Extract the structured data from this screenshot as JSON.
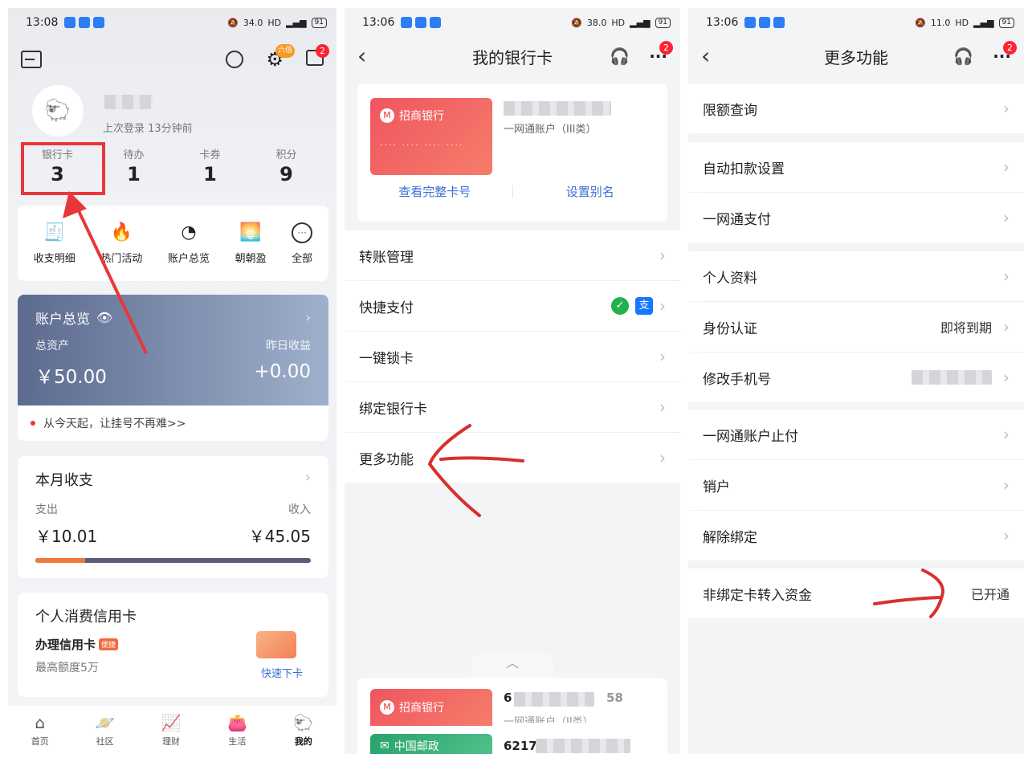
{
  "panel1": {
    "status": {
      "time": "13:08",
      "speed": "34.0",
      "net": "HD",
      "battery": "91"
    },
    "notif_count": "2",
    "vip_tag": "六倍",
    "profile": {
      "last_login": "上次登录 13分钟前"
    },
    "stats": [
      {
        "label": "银行卡",
        "value": "3"
      },
      {
        "label": "待办",
        "value": "1"
      },
      {
        "label": "卡券",
        "value": "1"
      },
      {
        "label": "积分",
        "value": "9"
      }
    ],
    "quick": [
      {
        "label": "收支明细",
        "icon": "receipt-icon"
      },
      {
        "label": "热门活动",
        "icon": "flame-icon"
      },
      {
        "label": "账户总览",
        "icon": "pie-chart-icon"
      },
      {
        "label": "朝朝盈",
        "icon": "sunrise-icon"
      },
      {
        "label": "全部",
        "icon": "more-icon"
      }
    ],
    "account": {
      "title": "账户总览",
      "total_label": "总资产",
      "yesterday_label": "昨日收益",
      "total": "￥50.00",
      "yesterday": "+0.00"
    },
    "notice": "从今天起，让挂号不再难>>",
    "monthly": {
      "title": "本月收支",
      "out_label": "支出",
      "in_label": "收入",
      "out": "￥10.01",
      "in": "￥45.05",
      "out_ratio": 0.18
    },
    "credit": {
      "title": "个人消费信用卡",
      "apply": "办理信用卡",
      "tag": "便捷",
      "limit": "最高额度5万",
      "fast": "快速下卡"
    },
    "tabs": [
      {
        "label": "首页",
        "icon": "home-icon"
      },
      {
        "label": "社区",
        "icon": "planet-icon"
      },
      {
        "label": "理财",
        "icon": "chart-up-icon"
      },
      {
        "label": "生活",
        "icon": "wallet-icon"
      },
      {
        "label": "我的",
        "icon": "profile-icon"
      }
    ]
  },
  "panel2": {
    "status": {
      "time": "13:06",
      "speed": "38.0",
      "net": "HD",
      "battery": "91"
    },
    "title": "我的银行卡",
    "notif_count": "2",
    "card": {
      "bank": "招商银行",
      "number_mask": "···· ···· ···· ····",
      "account_type": "一网通账户（III类）",
      "view_full": "查看完整卡号",
      "set_alias": "设置别名"
    },
    "menu": [
      "转账管理",
      "快捷支付",
      "一键锁卡",
      "绑定银行卡",
      "更多功能"
    ],
    "bottom_cards": [
      {
        "bank": "招商银行",
        "num_prefix": "6",
        "num_suffix": "58",
        "sub": "一网通账户（II类）"
      },
      {
        "bank": "中国邮政",
        "num_prefix": "6217",
        "num_suffix": ""
      }
    ]
  },
  "panel3": {
    "status": {
      "time": "13:06",
      "speed": "11.0",
      "net": "HD",
      "battery": "91"
    },
    "title": "更多功能",
    "notif_count": "2",
    "groups": [
      [
        {
          "label": "限额查询"
        }
      ],
      [
        {
          "label": "自动扣款设置"
        },
        {
          "label": "一网通支付"
        }
      ],
      [
        {
          "label": "个人资料"
        },
        {
          "label": "身份认证",
          "value": "即将到期"
        },
        {
          "label": "修改手机号"
        }
      ],
      [
        {
          "label": "一网通账户止付"
        },
        {
          "label": "销户"
        },
        {
          "label": "解除绑定"
        }
      ],
      [
        {
          "label": "非绑定卡转入资金",
          "value": "已开通"
        }
      ]
    ]
  }
}
